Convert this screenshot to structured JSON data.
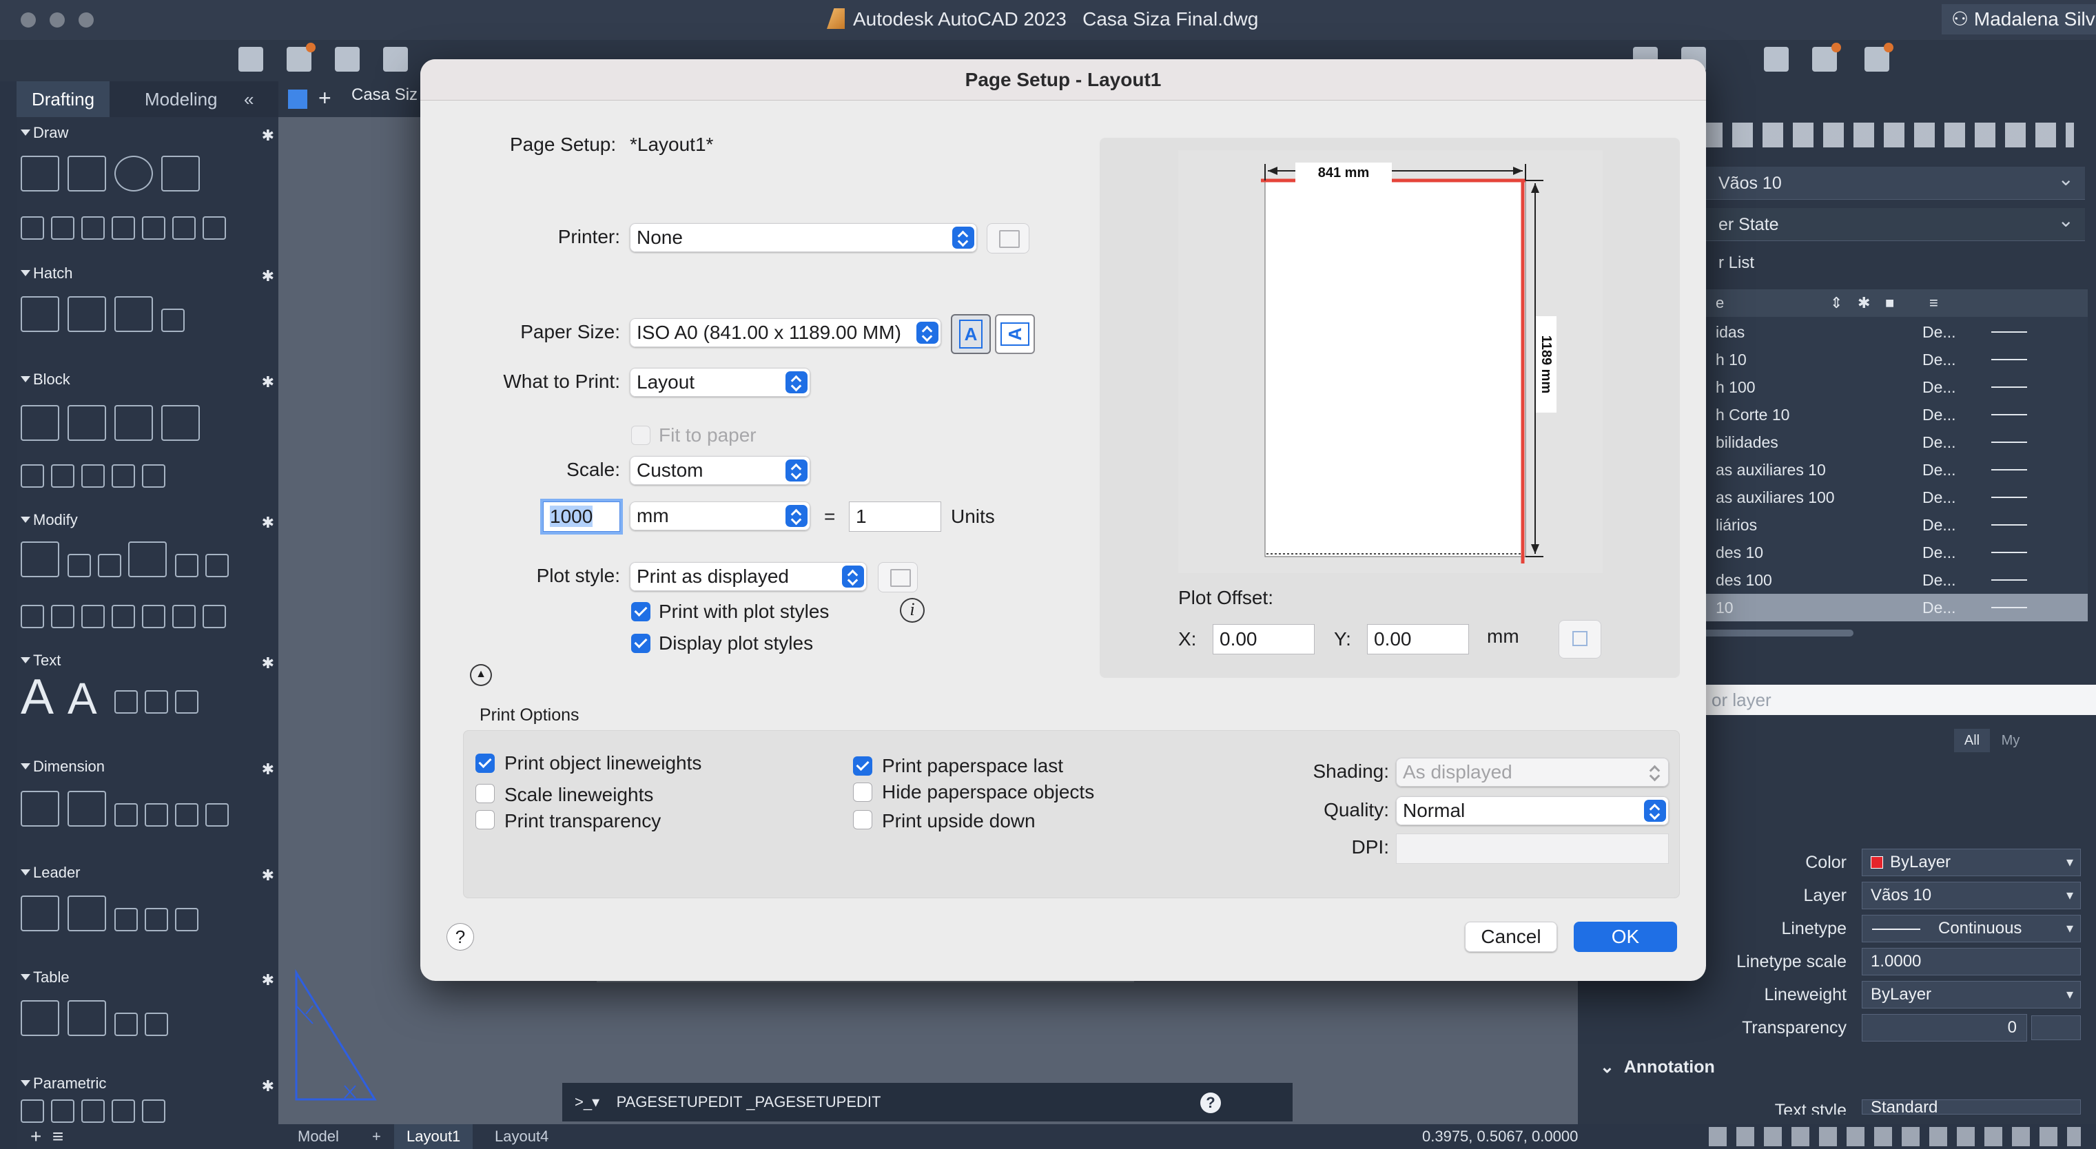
{
  "app": {
    "title": "Autodesk AutoCAD 2023",
    "filename": "Casa Siza Final.dwg",
    "user": "Madalena Silva"
  },
  "left_panel": {
    "tabs": [
      "Drafting",
      "Modeling"
    ],
    "collapse_glyph": "«",
    "sections": [
      "Draw",
      "Hatch",
      "Block",
      "Modify",
      "Text",
      "Dimension",
      "Leader",
      "Table",
      "Parametric"
    ]
  },
  "doc_tab": {
    "name": "Casa Siz"
  },
  "dialog": {
    "title": "Page Setup - Layout1",
    "page_setup_label": "Page Setup:",
    "page_setup_value": "*Layout1*",
    "printer_label": "Printer:",
    "printer_value": "None",
    "paper_size_label": "Paper Size:",
    "paper_size_value": "ISO A0 (841.00 x 1189.00 MM)",
    "orient_portrait": "A",
    "orient_landscape": "A",
    "what_to_print_label": "What to Print:",
    "what_to_print_value": "Layout",
    "fit_to_paper": "Fit to paper",
    "scale_label": "Scale:",
    "scale_value": "Custom",
    "scale_number": "1000",
    "scale_unit": "mm",
    "equals": "=",
    "scale_units_value": "1",
    "units_label": "Units",
    "plot_style_label": "Plot style:",
    "plot_style_value": "Print as displayed",
    "print_with_plot_styles": "Print with plot styles",
    "display_plot_styles": "Display plot styles",
    "info_glyph": "i",
    "collapse_glyph": "▲",
    "preview": {
      "width_label": "841 mm",
      "height_label": "1189 mm"
    },
    "plot_offset_label": "Plot Offset:",
    "x_label": "X:",
    "x_value": "0.00",
    "y_label": "Y:",
    "y_value": "0.00",
    "offset_unit": "mm",
    "print_options_title": "Print Options",
    "options": {
      "print_object_lineweights": "Print object lineweights",
      "scale_lineweights": "Scale lineweights",
      "print_transparency": "Print transparency",
      "print_paperspace_last": "Print paperspace last",
      "hide_paperspace_objects": "Hide paperspace objects",
      "print_upside_down": "Print upside down"
    },
    "shading_label": "Shading:",
    "shading_value": "As displayed",
    "quality_label": "Quality:",
    "quality_value": "Normal",
    "dpi_label": "DPI:",
    "help_glyph": "?",
    "cancel_label": "Cancel",
    "ok_label": "OK"
  },
  "right_panel": {
    "current_layer": "Vãos 10",
    "layer_state": "er State",
    "layer_list_label": "r List",
    "header_name": "e",
    "layers": [
      {
        "name": "idas",
        "desc": "De..."
      },
      {
        "name": "h 10",
        "desc": "De..."
      },
      {
        "name": "h 100",
        "desc": "De..."
      },
      {
        "name": "h Corte 10",
        "desc": "De..."
      },
      {
        "name": "bilidades",
        "desc": "De..."
      },
      {
        "name": "as auxiliares 10",
        "desc": "De..."
      },
      {
        "name": "as auxiliares 100",
        "desc": "De..."
      },
      {
        "name": "liários",
        "desc": "De..."
      },
      {
        "name": "des 10",
        "desc": "De..."
      },
      {
        "name": "des 100",
        "desc": "De..."
      },
      {
        "name": "10",
        "desc": "De..."
      }
    ],
    "filter_placeholder": "or layer",
    "filter_all": "All",
    "filter_my": "My",
    "properties": {
      "color_label": "Color",
      "color_value": "ByLayer",
      "layer_label": "Layer",
      "layer_value": "Vãos 10",
      "linetype_label": "Linetype",
      "linetype_value": "Continuous",
      "linetype_scale_label": "Linetype scale",
      "linetype_scale_value": "1.0000",
      "lineweight_label": "Lineweight",
      "lineweight_value": "ByLayer",
      "transparency_label": "Transparency",
      "transparency_value": "0"
    },
    "annotation_label": "Annotation",
    "text_style_label": "Text style",
    "text_style_value": "Standard"
  },
  "command_line": {
    "prompt": ">_▾",
    "text": "PAGESETUPEDIT _PAGESETUPEDIT"
  },
  "status_bar": {
    "tabs": [
      "Model",
      "Layout1",
      "Layout4"
    ],
    "add_glyph": "+",
    "coordinates": "0.3975, 0.5067, 0.0000"
  },
  "colors": {
    "accent": "#1f6fe5",
    "preview_margin": "#e5443a",
    "notification": "#ef7a2c"
  }
}
